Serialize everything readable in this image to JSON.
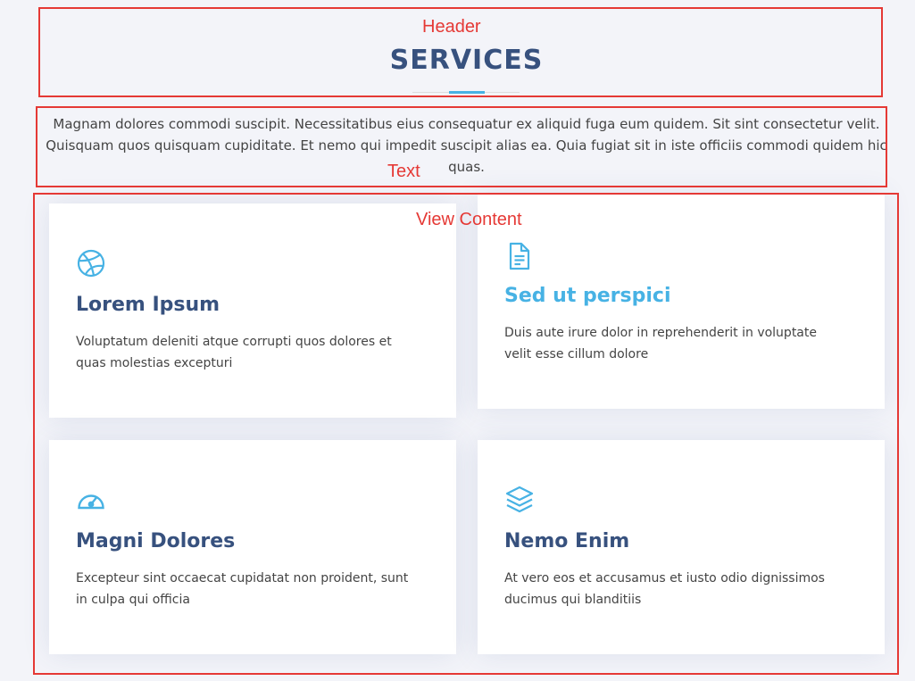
{
  "annotations": {
    "header": "Header",
    "text": "Text",
    "content": "View Content",
    "color": "#e53935"
  },
  "section": {
    "title": "SERVICES",
    "intro": "Magnam dolores commodi suscipit. Necessitatibus eius consequatur ex aliquid fuga eum quidem. Sit sint consectetur velit. Quisquam quos quisquam cupiditate. Et nemo qui impedit suscipit alias ea. Quia fugiat sit in iste officiis commodi quidem hic quas."
  },
  "colors": {
    "heading": "#37517e",
    "accent": "#47b2e4",
    "background": "#f3f4f9"
  },
  "cards": [
    {
      "icon": "dribbble-icon",
      "title": "Lorem Ipsum",
      "description": "Voluptatum deleniti atque corrupti quos dolores et quas molestias excepturi",
      "active": false
    },
    {
      "icon": "file-text-icon",
      "title": "Sed ut perspici",
      "description": "Duis aute irure dolor in reprehenderit in voluptate velit esse cillum dolore",
      "active": true
    },
    {
      "icon": "speedometer-icon",
      "title": "Magni Dolores",
      "description": "Excepteur sint occaecat cupidatat non proident, sunt in culpa qui officia",
      "active": false
    },
    {
      "icon": "layers-icon",
      "title": "Nemo Enim",
      "description": "At vero eos et accusamus et iusto odio dignissimos ducimus qui blanditiis",
      "active": false
    }
  ]
}
